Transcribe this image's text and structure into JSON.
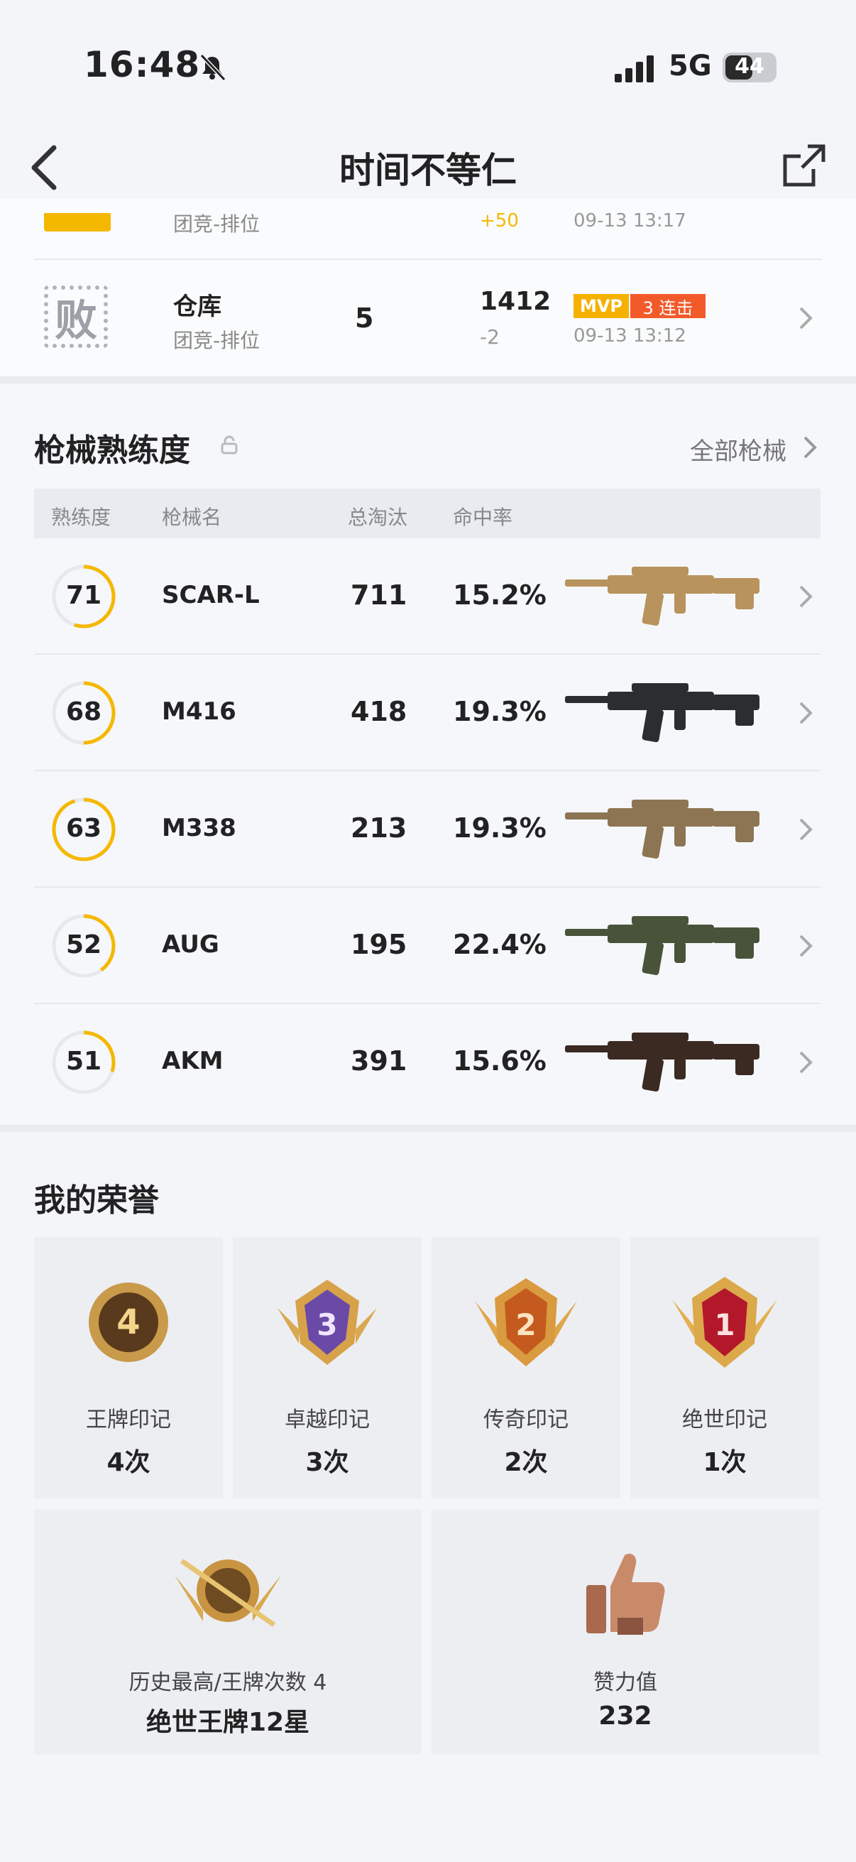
{
  "status_bar": {
    "time": "16:48",
    "network": "5G",
    "battery": "44"
  },
  "header": {
    "title": "时间不等仁"
  },
  "matches": [
    {
      "mode": "团竞-排位",
      "rating_delta": "+50",
      "time": "09-13 13:17"
    },
    {
      "result": "败",
      "map": "仓库",
      "mode": "团竞-排位",
      "kills": "5",
      "rating": "1412",
      "rating_delta": "-2",
      "badge_mvp": "MVP",
      "badge_streak": "3 连击",
      "time": "09-13 13:12"
    }
  ],
  "weapons": {
    "title": "枪械熟练度",
    "all_link": "全部枪械",
    "headers": [
      "熟练度",
      "枪械名",
      "总淘汰",
      "命中率"
    ],
    "rows": [
      {
        "level": "71",
        "name": "SCAR-L",
        "kills": "711",
        "accuracy": "15.2%",
        "progress": 0.55
      },
      {
        "level": "68",
        "name": "M416",
        "kills": "418",
        "accuracy": "19.3%",
        "progress": 0.5
      },
      {
        "level": "63",
        "name": "M338",
        "kills": "213",
        "accuracy": "19.3%",
        "progress": 0.95
      },
      {
        "level": "52",
        "name": "AUG",
        "kills": "195",
        "accuracy": "22.4%",
        "progress": 0.4
      },
      {
        "level": "51",
        "name": "AKM",
        "kills": "391",
        "accuracy": "15.6%",
        "progress": 0.3
      }
    ]
  },
  "honors": {
    "title": "我的荣誉",
    "marks": [
      {
        "badge": "4",
        "label": "王牌印记",
        "value": "4次"
      },
      {
        "badge": "3",
        "label": "卓越印记",
        "value": "3次"
      },
      {
        "badge": "2",
        "label": "传奇印记",
        "value": "2次"
      },
      {
        "badge": "1",
        "label": "绝世印记",
        "value": "1次"
      }
    ],
    "best": {
      "label": "历史最高/王牌次数 4",
      "value": "绝世王牌12星"
    },
    "likes": {
      "label": "赞力值",
      "value": "232"
    }
  },
  "colors": {
    "accent": "#f5b800",
    "mvp": "#f6b000",
    "streak": "#f35a2a"
  }
}
